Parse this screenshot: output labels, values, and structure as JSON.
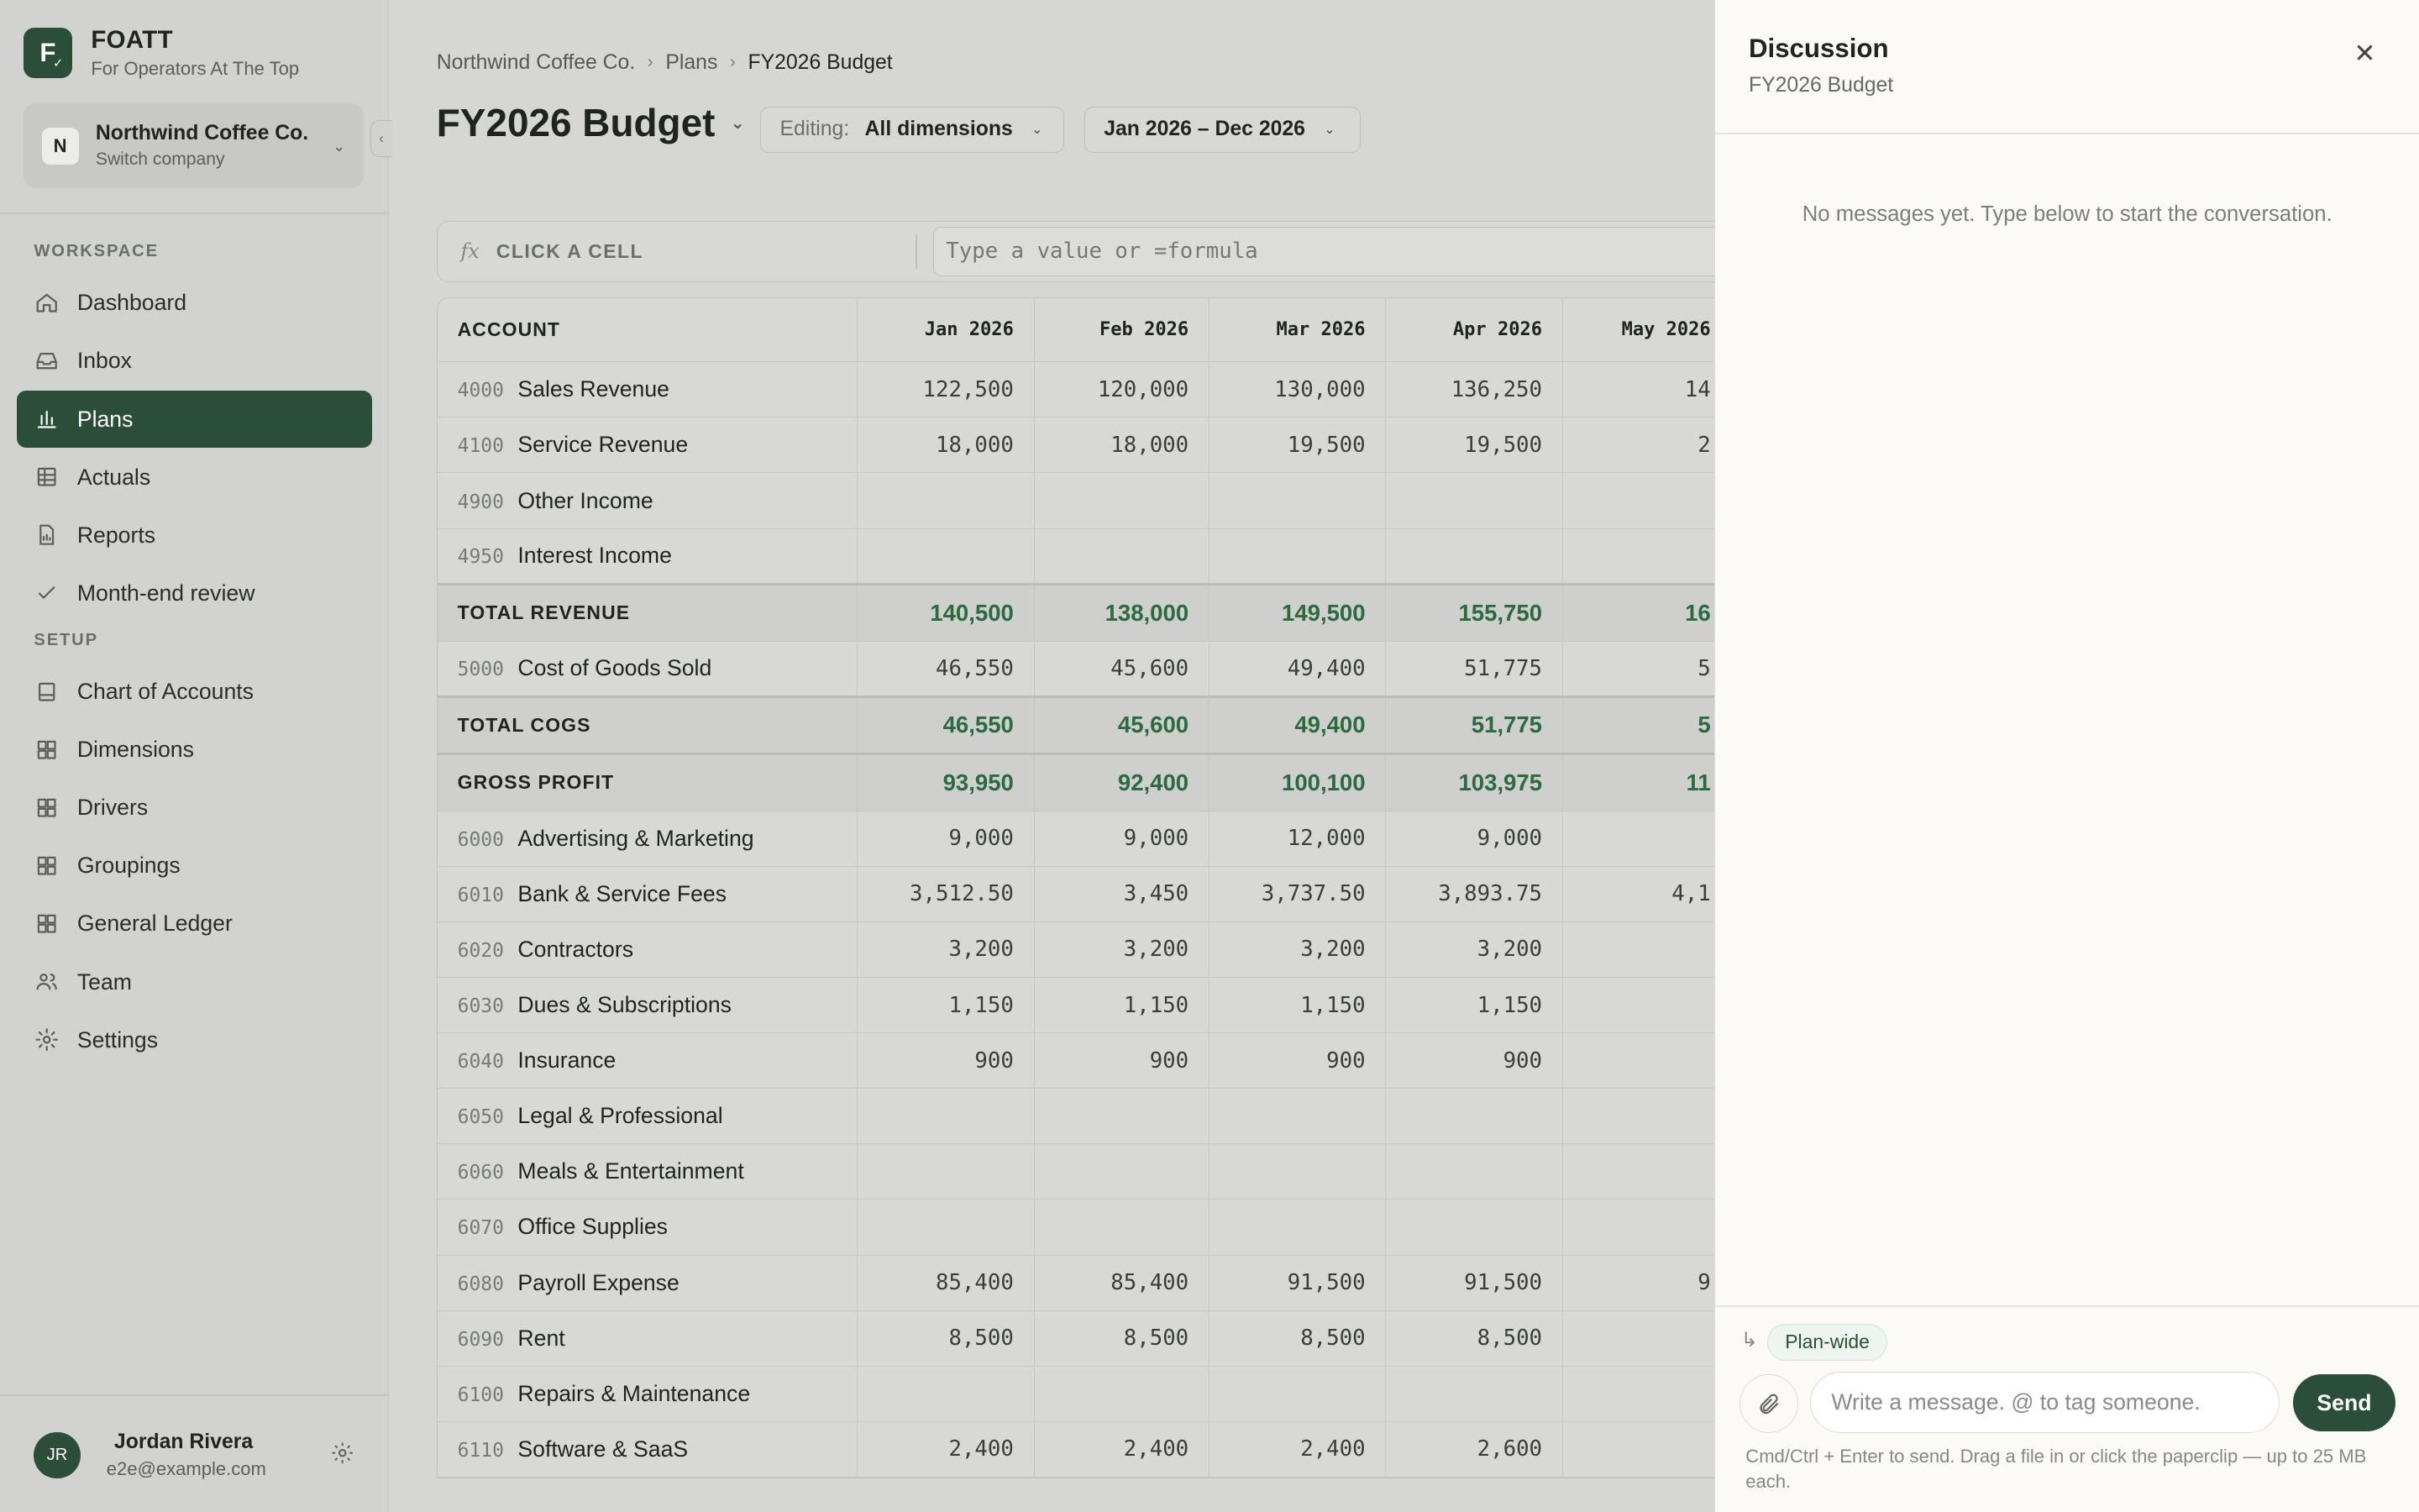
{
  "brand": {
    "name": "FOATT",
    "tagline": "For Operators At The Top",
    "logo_letter": "F"
  },
  "company": {
    "initial": "N",
    "name": "Northwind Coffee Co.",
    "sub": "Switch company"
  },
  "sidebar": {
    "workspace_label": "WORKSPACE",
    "setup_label": "SETUP",
    "workspace_items": [
      {
        "label": "Dashboard",
        "icon": "home-icon"
      },
      {
        "label": "Inbox",
        "icon": "inbox-icon"
      },
      {
        "label": "Plans",
        "icon": "bar-chart-icon",
        "active": true
      },
      {
        "label": "Actuals",
        "icon": "table-icon"
      },
      {
        "label": "Reports",
        "icon": "file-chart-icon"
      },
      {
        "label": "Month-end review",
        "icon": "check-icon"
      }
    ],
    "setup_items": [
      {
        "label": "Chart of Accounts",
        "icon": "book-icon"
      },
      {
        "label": "Dimensions",
        "icon": "grid-icon"
      },
      {
        "label": "Drivers",
        "icon": "grid-icon"
      },
      {
        "label": "Groupings",
        "icon": "grid-icon"
      },
      {
        "label": "General Ledger",
        "icon": "grid-icon"
      },
      {
        "label": "Team",
        "icon": "users-icon"
      },
      {
        "label": "Settings",
        "icon": "gear-icon"
      }
    ]
  },
  "user": {
    "initials": "JR",
    "name": "Jordan Rivera",
    "email": "e2e@example.com"
  },
  "breadcrumb": [
    "Northwind Coffee Co.",
    "Plans",
    "FY2026 Budget"
  ],
  "page_title": "FY2026 Budget",
  "editing": {
    "label": "Editing:",
    "value": "All dimensions"
  },
  "date_range": "Jan 2026 – Dec 2026",
  "formula_bar": {
    "fx": "fx",
    "cell_ref": "CLICK A CELL",
    "placeholder": "Type a value or =formula"
  },
  "grid": {
    "account_header": "ACCOUNT",
    "months": [
      "Jan 2026",
      "Feb 2026",
      "Mar 2026",
      "Apr 2026",
      "May 2026"
    ],
    "rows": [
      {
        "code": "4000",
        "name": "Sales Revenue",
        "values": [
          "122,500",
          "120,000",
          "130,000",
          "136,250",
          "14"
        ]
      },
      {
        "code": "4100",
        "name": "Service Revenue",
        "values": [
          "18,000",
          "18,000",
          "19,500",
          "19,500",
          "2"
        ]
      },
      {
        "code": "4900",
        "name": "Other Income",
        "values": [
          "",
          "",
          "",
          "",
          ""
        ]
      },
      {
        "code": "4950",
        "name": "Interest Income",
        "values": [
          "",
          "",
          "",
          "",
          ""
        ]
      },
      {
        "code": "",
        "name": "TOTAL REVENUE",
        "total": true,
        "values": [
          "140,500",
          "138,000",
          "149,500",
          "155,750",
          "16"
        ]
      },
      {
        "code": "5000",
        "name": "Cost of Goods Sold",
        "values": [
          "46,550",
          "45,600",
          "49,400",
          "51,775",
          "5"
        ]
      },
      {
        "code": "",
        "name": "TOTAL COGS",
        "total": true,
        "values": [
          "46,550",
          "45,600",
          "49,400",
          "51,775",
          "5"
        ]
      },
      {
        "code": "",
        "name": "GROSS PROFIT",
        "total": true,
        "values": [
          "93,950",
          "92,400",
          "100,100",
          "103,975",
          "11"
        ]
      },
      {
        "code": "6000",
        "name": "Advertising & Marketing",
        "values": [
          "9,000",
          "9,000",
          "12,000",
          "9,000",
          ""
        ]
      },
      {
        "code": "6010",
        "name": "Bank & Service Fees",
        "values": [
          "3,512.50",
          "3,450",
          "3,737.50",
          "3,893.75",
          "4,1"
        ]
      },
      {
        "code": "6020",
        "name": "Contractors",
        "values": [
          "3,200",
          "3,200",
          "3,200",
          "3,200",
          ""
        ]
      },
      {
        "code": "6030",
        "name": "Dues & Subscriptions",
        "values": [
          "1,150",
          "1,150",
          "1,150",
          "1,150",
          ""
        ]
      },
      {
        "code": "6040",
        "name": "Insurance",
        "values": [
          "900",
          "900",
          "900",
          "900",
          ""
        ]
      },
      {
        "code": "6050",
        "name": "Legal & Professional",
        "values": [
          "",
          "",
          "",
          "",
          ""
        ]
      },
      {
        "code": "6060",
        "name": "Meals & Entertainment",
        "values": [
          "",
          "",
          "",
          "",
          ""
        ]
      },
      {
        "code": "6070",
        "name": "Office Supplies",
        "values": [
          "",
          "",
          "",
          "",
          ""
        ]
      },
      {
        "code": "6080",
        "name": "Payroll Expense",
        "values": [
          "85,400",
          "85,400",
          "91,500",
          "91,500",
          "9"
        ]
      },
      {
        "code": "6090",
        "name": "Rent",
        "values": [
          "8,500",
          "8,500",
          "8,500",
          "8,500",
          ""
        ]
      },
      {
        "code": "6100",
        "name": "Repairs & Maintenance",
        "values": [
          "",
          "",
          "",
          "",
          ""
        ]
      },
      {
        "code": "6110",
        "name": "Software & SaaS",
        "values": [
          "2,400",
          "2,400",
          "2,400",
          "2,600",
          ""
        ]
      }
    ]
  },
  "discussion": {
    "title": "Discussion",
    "subtitle": "FY2026 Budget",
    "empty": "No messages yet. Type below to start the conversation.",
    "scope": "Plan-wide",
    "input_placeholder": "Write a message. @ to tag someone.",
    "send_label": "Send",
    "hint": "Cmd/Ctrl + Enter to send. Drag a file in or click the paperclip — up to 25 MB each."
  },
  "colors": {
    "accent": "#2a4e37",
    "total_value": "#2a6b3f"
  }
}
